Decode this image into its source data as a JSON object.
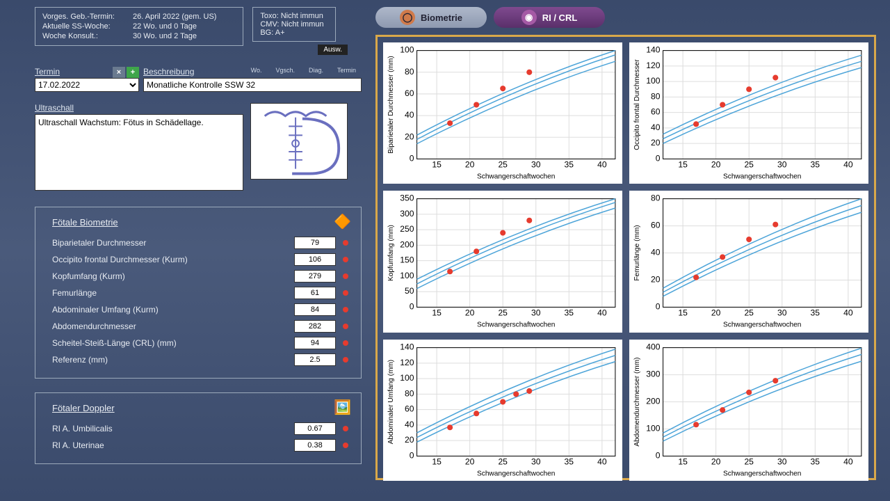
{
  "info1": {
    "r1l": "Vorges. Geb.-Termin:",
    "r1v": "26. April 2022 (gem. US)",
    "r2l": "Aktuelle SS-Woche:",
    "r2v": "22 Wo. und 0 Tage",
    "r3l": "Woche Konsult.:",
    "r3v": "30 Wo. und 2 Tage"
  },
  "info2": {
    "l1": "Toxo: Nicht immun",
    "l2": "CMV: Nicht immun",
    "l3": "BG: A+"
  },
  "ausw": "Ausw.",
  "labels": {
    "termin": "Termin",
    "beschreibung": "Beschreibung",
    "ultraschall": "Ultraschall",
    "wo": "Wo.",
    "vgsch": "Vgsch.",
    "diag": "Diag.",
    "terminCol": "Termin"
  },
  "termin_value": "17.02.2022",
  "desc_value": "Monatliche Kontrolle SSW 32",
  "ultra_text": "Ultraschall Wachstum: Fötus in Schädellage.",
  "biom_title": "Fötale Biometrie",
  "biom": [
    {
      "l": "Biparietaler Durchmesser",
      "v": "79"
    },
    {
      "l": "Occipito frontal Durchmesser (Kurm)",
      "v": "106"
    },
    {
      "l": "Kopfumfang (Kurm)",
      "v": "279"
    },
    {
      "l": "Femurlänge",
      "v": "61"
    },
    {
      "l": "Abdominaler Umfang (Kurm)",
      "v": "84"
    },
    {
      "l": "Abdomendurchmesser",
      "v": "282"
    },
    {
      "l": "Scheitel-Steiß-Länge (CRL) (mm)",
      "v": "94"
    },
    {
      "l": "Referenz (mm)",
      "v": "2.5"
    }
  ],
  "doppler_title": "Fötaler Doppler",
  "doppler": [
    {
      "l": "RI A. Umbilicalis",
      "v": "0.67"
    },
    {
      "l": "RI A. Uterinae",
      "v": "0.38"
    }
  ],
  "tabs": {
    "t1": "Biometrie",
    "t2": "RI / CRL"
  },
  "xlabel": "Schwangerschaftwochen",
  "chart_data": [
    {
      "type": "scatter",
      "ylabel": "Biparietaler Durchmesser (mm)",
      "xlim": [
        12,
        42
      ],
      "ylim": [
        0,
        100
      ],
      "yticks": [
        0,
        20,
        40,
        60,
        80,
        100
      ],
      "xticks": [
        15,
        20,
        25,
        30,
        35,
        40
      ],
      "points": [
        {
          "x": 17,
          "y": 33
        },
        {
          "x": 21,
          "y": 50
        },
        {
          "x": 25,
          "y": 65
        },
        {
          "x": 29,
          "y": 80
        }
      ],
      "curves": {
        "lo": [
          [
            12,
            14
          ],
          [
            42,
            90
          ]
        ],
        "mid": [
          [
            12,
            18
          ],
          [
            42,
            96
          ]
        ],
        "hi": [
          [
            12,
            22
          ],
          [
            42,
            100
          ]
        ]
      }
    },
    {
      "type": "scatter",
      "ylabel": "Occipito frontal Durchmesser",
      "xlim": [
        12,
        42
      ],
      "ylim": [
        0,
        140
      ],
      "yticks": [
        0,
        20,
        40,
        60,
        80,
        100,
        120,
        140
      ],
      "xticks": [
        15,
        20,
        25,
        30,
        35,
        40
      ],
      "points": [
        {
          "x": 17,
          "y": 45
        },
        {
          "x": 21,
          "y": 70
        },
        {
          "x": 25,
          "y": 90
        },
        {
          "x": 29,
          "y": 105
        }
      ],
      "curves": {
        "lo": [
          [
            12,
            20
          ],
          [
            42,
            118
          ]
        ],
        "mid": [
          [
            12,
            26
          ],
          [
            42,
            126
          ]
        ],
        "hi": [
          [
            12,
            32
          ],
          [
            42,
            134
          ]
        ]
      }
    },
    {
      "type": "scatter",
      "ylabel": "Kopfumfang (mm)",
      "xlim": [
        12,
        42
      ],
      "ylim": [
        0,
        350
      ],
      "yticks": [
        0,
        50,
        100,
        150,
        200,
        250,
        300,
        350
      ],
      "xticks": [
        15,
        20,
        25,
        30,
        35,
        40
      ],
      "points": [
        {
          "x": 17,
          "y": 115
        },
        {
          "x": 21,
          "y": 180
        },
        {
          "x": 25,
          "y": 240
        },
        {
          "x": 29,
          "y": 280
        }
      ],
      "curves": {
        "lo": [
          [
            12,
            60
          ],
          [
            42,
            320
          ]
        ],
        "mid": [
          [
            12,
            75
          ],
          [
            42,
            338
          ]
        ],
        "hi": [
          [
            12,
            90
          ],
          [
            42,
            350
          ]
        ]
      }
    },
    {
      "type": "scatter",
      "ylabel": "Femurlänge (mm)",
      "xlim": [
        12,
        42
      ],
      "ylim": [
        0,
        80
      ],
      "yticks": [
        0,
        20,
        40,
        60,
        80
      ],
      "xticks": [
        15,
        20,
        25,
        30,
        35,
        40
      ],
      "points": [
        {
          "x": 17,
          "y": 22
        },
        {
          "x": 21,
          "y": 37
        },
        {
          "x": 25,
          "y": 50
        },
        {
          "x": 29,
          "y": 61
        }
      ],
      "curves": {
        "lo": [
          [
            12,
            8
          ],
          [
            42,
            70
          ]
        ],
        "mid": [
          [
            12,
            11
          ],
          [
            42,
            75
          ]
        ],
        "hi": [
          [
            12,
            14
          ],
          [
            42,
            80
          ]
        ]
      }
    },
    {
      "type": "scatter",
      "ylabel": "Abdominaler Umfang (mm)",
      "xlim": [
        12,
        42
      ],
      "ylim": [
        0,
        140
      ],
      "yticks": [
        0,
        20,
        40,
        60,
        80,
        100,
        120,
        140
      ],
      "xticks": [
        15,
        20,
        25,
        30,
        35,
        40
      ],
      "points": [
        {
          "x": 17,
          "y": 37
        },
        {
          "x": 21,
          "y": 55
        },
        {
          "x": 25,
          "y": 70
        },
        {
          "x": 27,
          "y": 80
        },
        {
          "x": 29,
          "y": 84
        }
      ],
      "curves": {
        "lo": [
          [
            12,
            18
          ],
          [
            42,
            122
          ]
        ],
        "mid": [
          [
            12,
            24
          ],
          [
            42,
            130
          ]
        ],
        "hi": [
          [
            12,
            30
          ],
          [
            42,
            138
          ]
        ]
      }
    },
    {
      "type": "scatter",
      "ylabel": "Abdomendurchmesser (mm)",
      "xlim": [
        12,
        42
      ],
      "ylim": [
        0,
        400
      ],
      "yticks": [
        0,
        100,
        200,
        300,
        400
      ],
      "xticks": [
        15,
        20,
        25,
        30,
        35,
        40
      ],
      "points": [
        {
          "x": 17,
          "y": 116
        },
        {
          "x": 21,
          "y": 170
        },
        {
          "x": 25,
          "y": 235
        },
        {
          "x": 29,
          "y": 278
        }
      ],
      "curves": {
        "lo": [
          [
            12,
            55
          ],
          [
            42,
            350
          ]
        ],
        "mid": [
          [
            12,
            70
          ],
          [
            42,
            375
          ]
        ],
        "hi": [
          [
            12,
            85
          ],
          [
            42,
            398
          ]
        ]
      }
    }
  ]
}
